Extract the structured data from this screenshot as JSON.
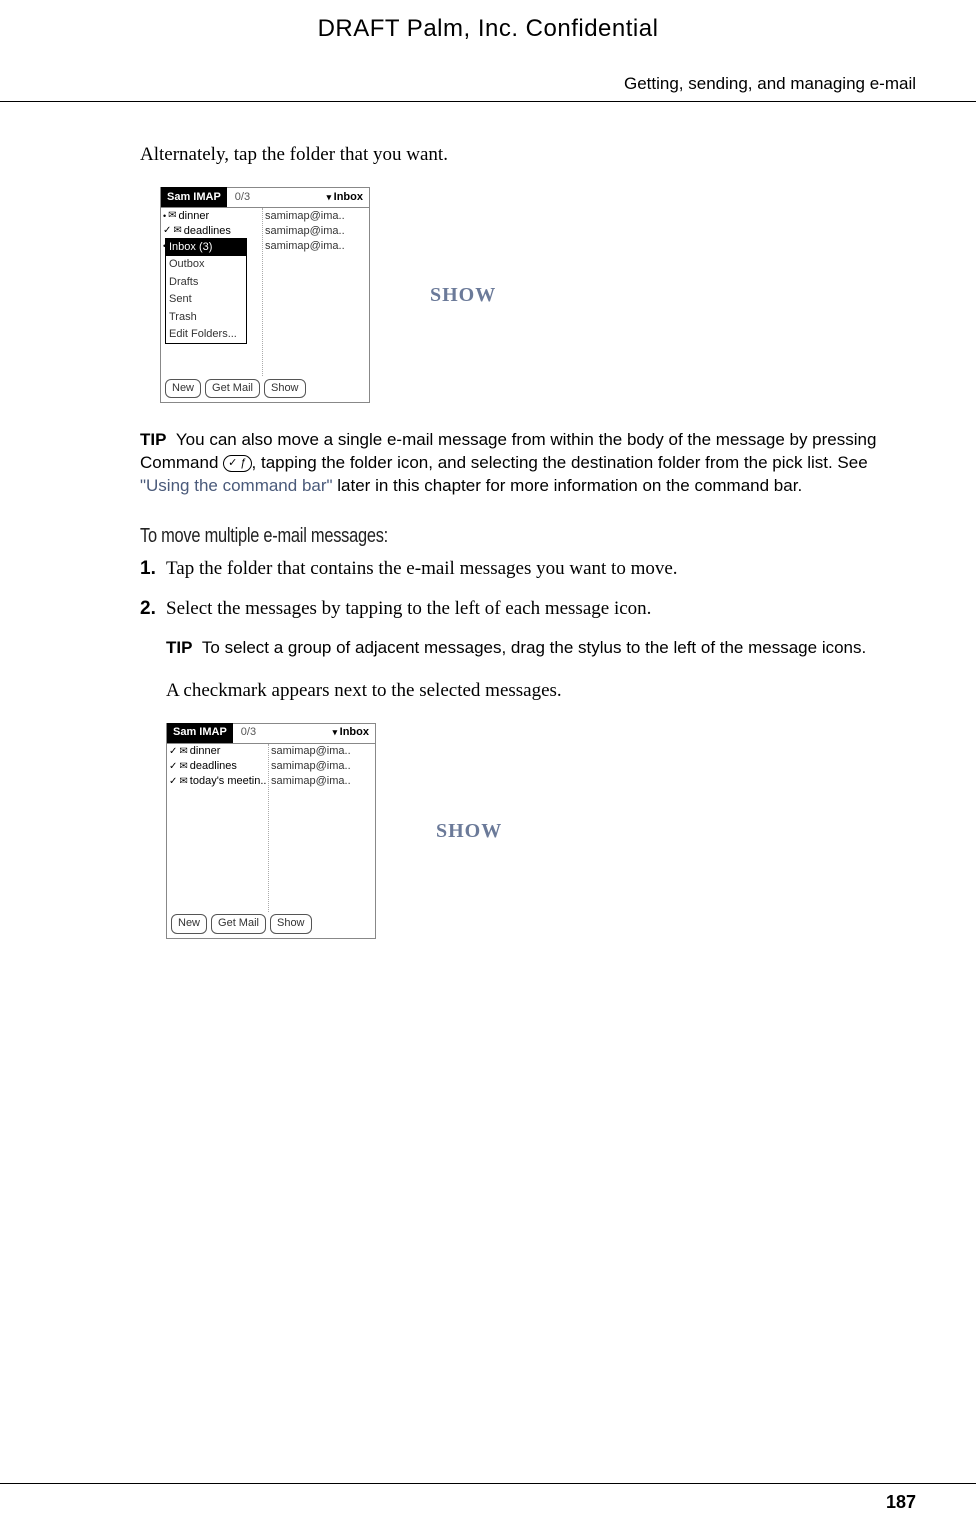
{
  "header": {
    "draft": "DRAFT   Palm, Inc. Confidential",
    "section": "Getting, sending, and managing e-mail"
  },
  "intro": "Alternately, tap the folder that you want.",
  "screenshot1": {
    "title": "Sam IMAP",
    "counter": "0/3",
    "folder": "Inbox",
    "left_rows": [
      {
        "mark": "•",
        "icon": "✉",
        "text": "dinner"
      },
      {
        "mark": "✓",
        "icon": "✉",
        "text": "deadlines"
      },
      {
        "mark": "•",
        "icon": "",
        "text": ""
      }
    ],
    "right_rows": [
      "samimap@ima..",
      "samimap@ima..",
      "samimap@ima.."
    ],
    "dropdown": {
      "selected": "Inbox (3)",
      "items": [
        "Outbox",
        "Drafts",
        "Sent",
        "Trash",
        "Edit Folders..."
      ]
    },
    "buttons": [
      "New",
      "Get Mail",
      "Show"
    ]
  },
  "show_label": "SHOW",
  "tip1": {
    "label": "TIP",
    "text_before": "You can also move a single e-mail message from within the body of the message by pressing Command ",
    "text_after": ", tapping the folder icon, and selecting the destination folder from the pick list. See ",
    "link": "\"Using the command bar\"",
    "text_end": " later in this chapter for more information on the command bar."
  },
  "subheading": "To move multiple e-mail messages:",
  "steps": [
    {
      "num": "1.",
      "text": "Tap the folder that contains the e-mail messages you want to move."
    },
    {
      "num": "2.",
      "text": "Select the messages by tapping to the left of each message icon."
    }
  ],
  "tip2": {
    "label": "TIP",
    "text": "To select a group of adjacent messages, drag the stylus to the left of the message icons."
  },
  "checkmark_text": "A checkmark appears next to the selected messages.",
  "screenshot2": {
    "title": "Sam IMAP",
    "counter": "0/3",
    "folder": "Inbox",
    "left_rows": [
      {
        "mark": "✓",
        "icon": "✉",
        "text": "dinner"
      },
      {
        "mark": "✓",
        "icon": "✉",
        "text": "deadlines"
      },
      {
        "mark": "✓",
        "icon": "✉",
        "text": "today's meetin.."
      }
    ],
    "right_rows": [
      "samimap@ima..",
      "samimap@ima..",
      "samimap@ima.."
    ],
    "buttons": [
      "New",
      "Get Mail",
      "Show"
    ]
  },
  "page_number": "187"
}
